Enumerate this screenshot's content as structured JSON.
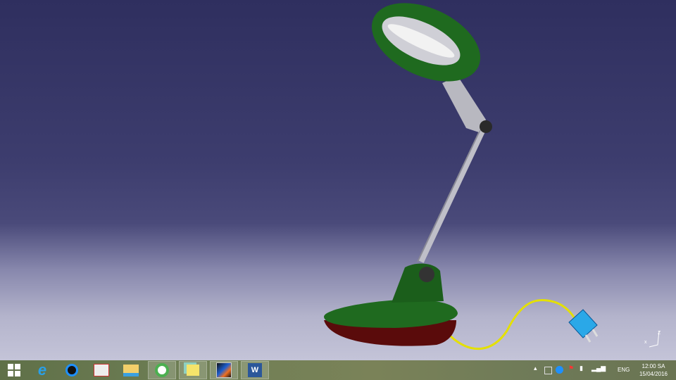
{
  "viewer": {
    "axis_labels": {
      "z": "Z",
      "x": "x",
      "y": "y"
    }
  },
  "taskbar": {
    "apps": [
      {
        "name": "start",
        "icon": "windows-logo-icon"
      },
      {
        "name": "internet-explorer",
        "icon": "ie-icon"
      },
      {
        "name": "ccleaner-like",
        "icon": "c-app-icon"
      },
      {
        "name": "unikey",
        "icon": "unikey-icon"
      },
      {
        "name": "file-explorer",
        "icon": "folder-icon"
      },
      {
        "name": "coc-coc",
        "icon": "coccoc-icon"
      },
      {
        "name": "sticky-notes",
        "icon": "notes-icon"
      },
      {
        "name": "catia",
        "icon": "catia-icon"
      },
      {
        "name": "word",
        "icon": "word-icon",
        "label": "W"
      }
    ],
    "tray": {
      "language": "ENG",
      "time": "12:00 SA",
      "date": "15/04/2016"
    }
  }
}
